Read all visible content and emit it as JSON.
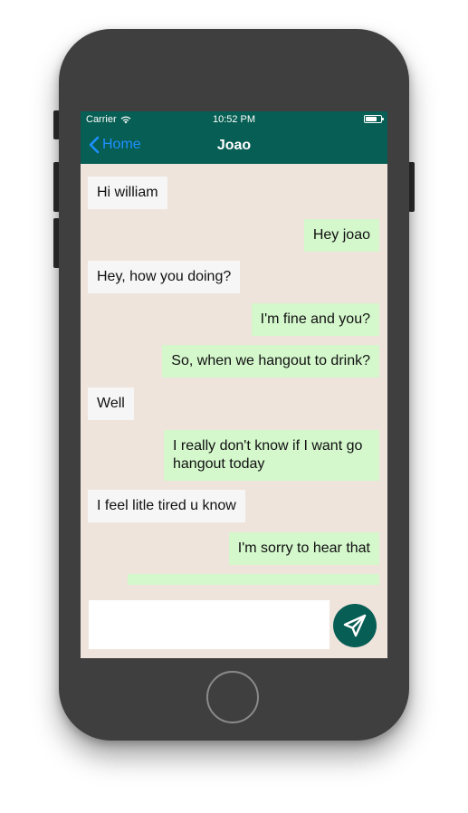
{
  "status_bar": {
    "carrier": "Carrier",
    "time": "10:52 PM"
  },
  "nav": {
    "back_label": "Home",
    "title": "Joao"
  },
  "messages": [
    {
      "text": "Hi william",
      "direction": "incoming"
    },
    {
      "text": "Hey joao",
      "direction": "outgoing"
    },
    {
      "text": "Hey, how you doing?",
      "direction": "incoming"
    },
    {
      "text": "I'm fine and you?",
      "direction": "outgoing"
    },
    {
      "text": "So, when we hangout to drink?",
      "direction": "outgoing"
    },
    {
      "text": "Well",
      "direction": "incoming"
    },
    {
      "text": "I really don't know if I want go hangout today",
      "direction": "outgoing"
    },
    {
      "text": "I feel litle tired u know",
      "direction": "incoming"
    },
    {
      "text": "I'm sorry to hear that",
      "direction": "outgoing"
    },
    {
      "text": "",
      "direction": "outgoing"
    }
  ],
  "composer": {
    "value": "",
    "placeholder": ""
  },
  "colors": {
    "header": "#075e54",
    "chat_background": "#efe4dc",
    "incoming_bubble": "#f6f6f6",
    "outgoing_bubble": "#d4f7cc",
    "back_link": "#1e90ff",
    "send_button": "#075e54",
    "device_body": "#3f3f3f"
  },
  "icons": {
    "back": "chevron-left-icon",
    "wifi": "wifi-icon",
    "battery": "battery-icon",
    "send": "paper-plane-icon"
  }
}
